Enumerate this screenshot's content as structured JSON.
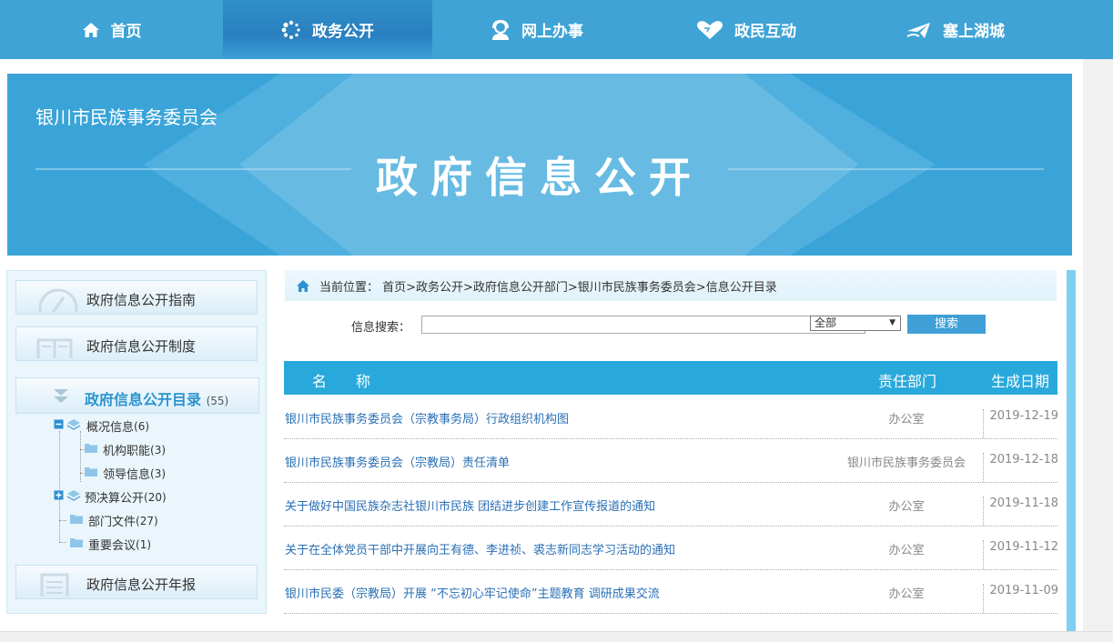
{
  "nav": {
    "items": [
      {
        "label": "首页",
        "icon": "home-icon"
      },
      {
        "label": "政务公开",
        "icon": "spinner-dots-icon"
      },
      {
        "label": "网上办事",
        "icon": "service-person-icon"
      },
      {
        "label": "政民互动",
        "icon": "heart-icon"
      },
      {
        "label": "塞上湖城",
        "icon": "plane-icon"
      }
    ],
    "active_index": 1
  },
  "banner": {
    "org_name": "银川市民族事务委员会",
    "title": "政府信息公开"
  },
  "sidebar": {
    "guide": "政府信息公开指南",
    "system": "政府信息公开制度",
    "catalog": "政府信息公开目录",
    "catalog_count": "(55)",
    "annual_report": "政府信息公开年报",
    "tree": [
      {
        "label": "概况信息",
        "count": "(6)"
      },
      {
        "label": "机构职能",
        "count": "(3)"
      },
      {
        "label": "领导信息",
        "count": "(3)"
      },
      {
        "label": "预决算公开",
        "count": "(20)"
      },
      {
        "label": "部门文件",
        "count": "(27)"
      },
      {
        "label": "重要会议",
        "count": "(1)"
      }
    ]
  },
  "breadcrumb": {
    "text": "当前位置： 首页>政务公开>政府信息公开部门>银川市民族事务委员会>信息公开目录"
  },
  "search": {
    "label": "信息搜索：",
    "value": "",
    "select_value": "全部",
    "button": "搜索"
  },
  "table": {
    "headers": {
      "name": "名　　称",
      "dept": "责任部门",
      "date": "生成日期"
    },
    "rows": [
      {
        "title": "银川市民族事务委员会（宗教事务局）行政组织机构图",
        "dept": "办公室",
        "date": "2019-12-19"
      },
      {
        "title": "银川市民族事务委员会（宗教局）责任清单",
        "dept": "银川市民族事务委员会",
        "date": "2019-12-18"
      },
      {
        "title": "关于做好中国民族杂志社银川市民族 团结进步创建工作宣传报道的通知",
        "dept": "办公室",
        "date": "2019-11-18"
      },
      {
        "title": "关于在全体党员干部中开展向王有德、李进祯、裘志新同志学习活动的通知",
        "dept": "办公室",
        "date": "2019-11-12"
      },
      {
        "title": "银川市民委（宗教局）开展 “不忘初心牢记使命”主题教育 调研成果交流",
        "dept": "办公室",
        "date": "2019-11-09"
      }
    ]
  },
  "colors": {
    "nav_bg": "#3fa3d6",
    "banner_bg": "#3aa4d8",
    "table_header": "#29a9db",
    "link": "#2a6fb5",
    "accent": "#2b93d0"
  }
}
